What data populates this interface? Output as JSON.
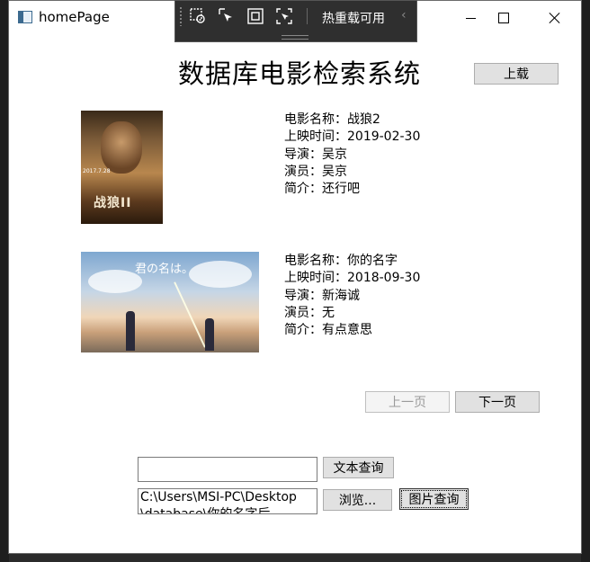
{
  "window": {
    "title": "homePage"
  },
  "devtools": {
    "hot_reload_label": "热重载可用",
    "icons": [
      "select-element-icon",
      "pointer-icon",
      "frame-icon",
      "track-focus-icon"
    ]
  },
  "header": {
    "title": "数据库电影检索系统",
    "upload_label": "上载"
  },
  "movies": [
    {
      "name_label": "电影名称：战狼2",
      "release_label": "上映时间：2019-02-30",
      "director_label": "导演：吴京",
      "actor_label": "演员：吴京",
      "summary_label": "简介：还行吧",
      "poster_text": "战狼II",
      "poster_date": "2017.7.28"
    },
    {
      "name_label": "电影名称：你的名字",
      "release_label": "上映时间：2018-09-30",
      "director_label": "导演：新海诚",
      "actor_label": "演员：无",
      "summary_label": "简介：有点意思",
      "poster_text": "君の名は。"
    }
  ],
  "pagination": {
    "prev_label": "上一页",
    "next_label": "下一页"
  },
  "search": {
    "text_value": "",
    "text_search_label": "文本查询",
    "path_value_line1": "C:\\Users\\MSI-PC\\Desktop",
    "path_value_line2": "\\database\\你的名字后",
    "browse_label": "浏览...",
    "image_search_label": "图片查询"
  },
  "colors": {
    "button_bg": "#e1e1e1",
    "button_border": "#adadad",
    "disabled_text": "#9a9a9a",
    "devbar_bg": "#2f2f2f"
  }
}
